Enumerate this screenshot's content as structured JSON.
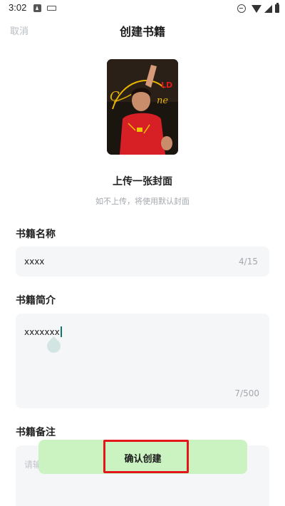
{
  "status_bar": {
    "time": "3:02",
    "icons": [
      "app-a-icon",
      "keyboard-icon",
      "do-not-disturb-icon",
      "wifi-icon",
      "cellular-icon",
      "battery-icon"
    ]
  },
  "nav": {
    "cancel_label": "取消",
    "title": "创建书籍"
  },
  "cover": {
    "upload_title": "上传一张封面",
    "upload_hint": "如不上传，将使用默认封面"
  },
  "form": {
    "name": {
      "label": "书籍名称",
      "value": "xxxx",
      "counter": "4/15"
    },
    "intro": {
      "label": "书籍简介",
      "value": "xxxxxxx",
      "counter": "7/500"
    },
    "note": {
      "label": "书籍备注",
      "placeholder": "请输"
    }
  },
  "confirm": {
    "label": "确认创建"
  },
  "colors": {
    "confirm_bg": "#cbf3c2",
    "highlight_border": "#e4161b",
    "field_bg": "#f5f6f8",
    "caret": "#0e7a6b"
  }
}
